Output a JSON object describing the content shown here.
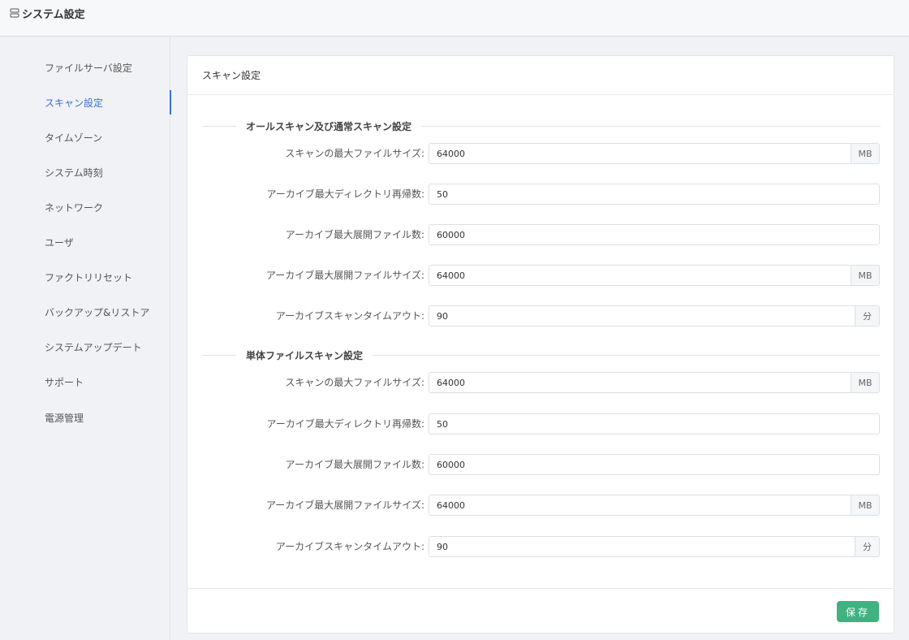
{
  "header": {
    "title": "システム設定",
    "icon": "server-icon"
  },
  "sidebar": {
    "items": [
      {
        "label": "ファイルサーバ設定",
        "active": false
      },
      {
        "label": "スキャン設定",
        "active": true
      },
      {
        "label": "タイムゾーン",
        "active": false
      },
      {
        "label": "システム時刻",
        "active": false
      },
      {
        "label": "ネットワーク",
        "active": false
      },
      {
        "label": "ユーザ",
        "active": false
      },
      {
        "label": "ファクトリリセット",
        "active": false
      },
      {
        "label": "バックアップ&リストア",
        "active": false
      },
      {
        "label": "システムアップデート",
        "active": false
      },
      {
        "label": "サポート",
        "active": false
      },
      {
        "label": "電源管理",
        "active": false
      }
    ]
  },
  "card": {
    "title": "スキャン設定",
    "sections": [
      {
        "title": "オールスキャン及び通常スキャン設定",
        "fields": [
          {
            "label": "スキャンの最大ファイルサイズ:",
            "value": "64000",
            "suffix": "MB"
          },
          {
            "label": "アーカイブ最大ディレクトリ再帰数:",
            "value": "50",
            "suffix": ""
          },
          {
            "label": "アーカイブ最大展開ファイル数:",
            "value": "60000",
            "suffix": ""
          },
          {
            "label": "アーカイブ最大展開ファイルサイズ:",
            "value": "64000",
            "suffix": "MB"
          },
          {
            "label": "アーカイブスキャンタイムアウト:",
            "value": "90",
            "suffix": "分"
          }
        ]
      },
      {
        "title": "単体ファイルスキャン設定",
        "fields": [
          {
            "label": "スキャンの最大ファイルサイズ:",
            "value": "64000",
            "suffix": "MB"
          },
          {
            "label": "アーカイブ最大ディレクトリ再帰数:",
            "value": "50",
            "suffix": ""
          },
          {
            "label": "アーカイブ最大展開ファイル数:",
            "value": "60000",
            "suffix": ""
          },
          {
            "label": "アーカイブ最大展開ファイルサイズ:",
            "value": "64000",
            "suffix": "MB"
          },
          {
            "label": "アーカイブスキャンタイムアウト:",
            "value": "90",
            "suffix": "分"
          }
        ]
      }
    ],
    "save_label": "保存"
  },
  "colors": {
    "accent": "#3b6ed8",
    "save": "#3fb27f"
  }
}
